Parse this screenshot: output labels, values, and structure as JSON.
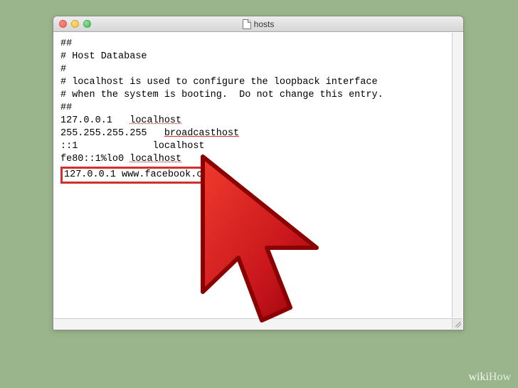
{
  "window": {
    "title": "hosts"
  },
  "content": {
    "l1": "##",
    "l2": "# Host Database",
    "l3": "#",
    "l4": "# localhost is used to configure the loopback interface",
    "l5": "# when the system is booting.  Do not change this entry.",
    "l6": "##",
    "l7_ip": "127.0.0.1   ",
    "l7_host": "localhost",
    "l8_ip": "255.255.255.255   ",
    "l8_host": "broadcasthost",
    "l9": "::1             localhost",
    "l10_ip": "fe80::1%lo0 ",
    "l10_host": "localhost",
    "highlight": "127.0.0.1 www.facebook.com"
  },
  "watermark": {
    "wiki": "wiki",
    "how": "How"
  }
}
